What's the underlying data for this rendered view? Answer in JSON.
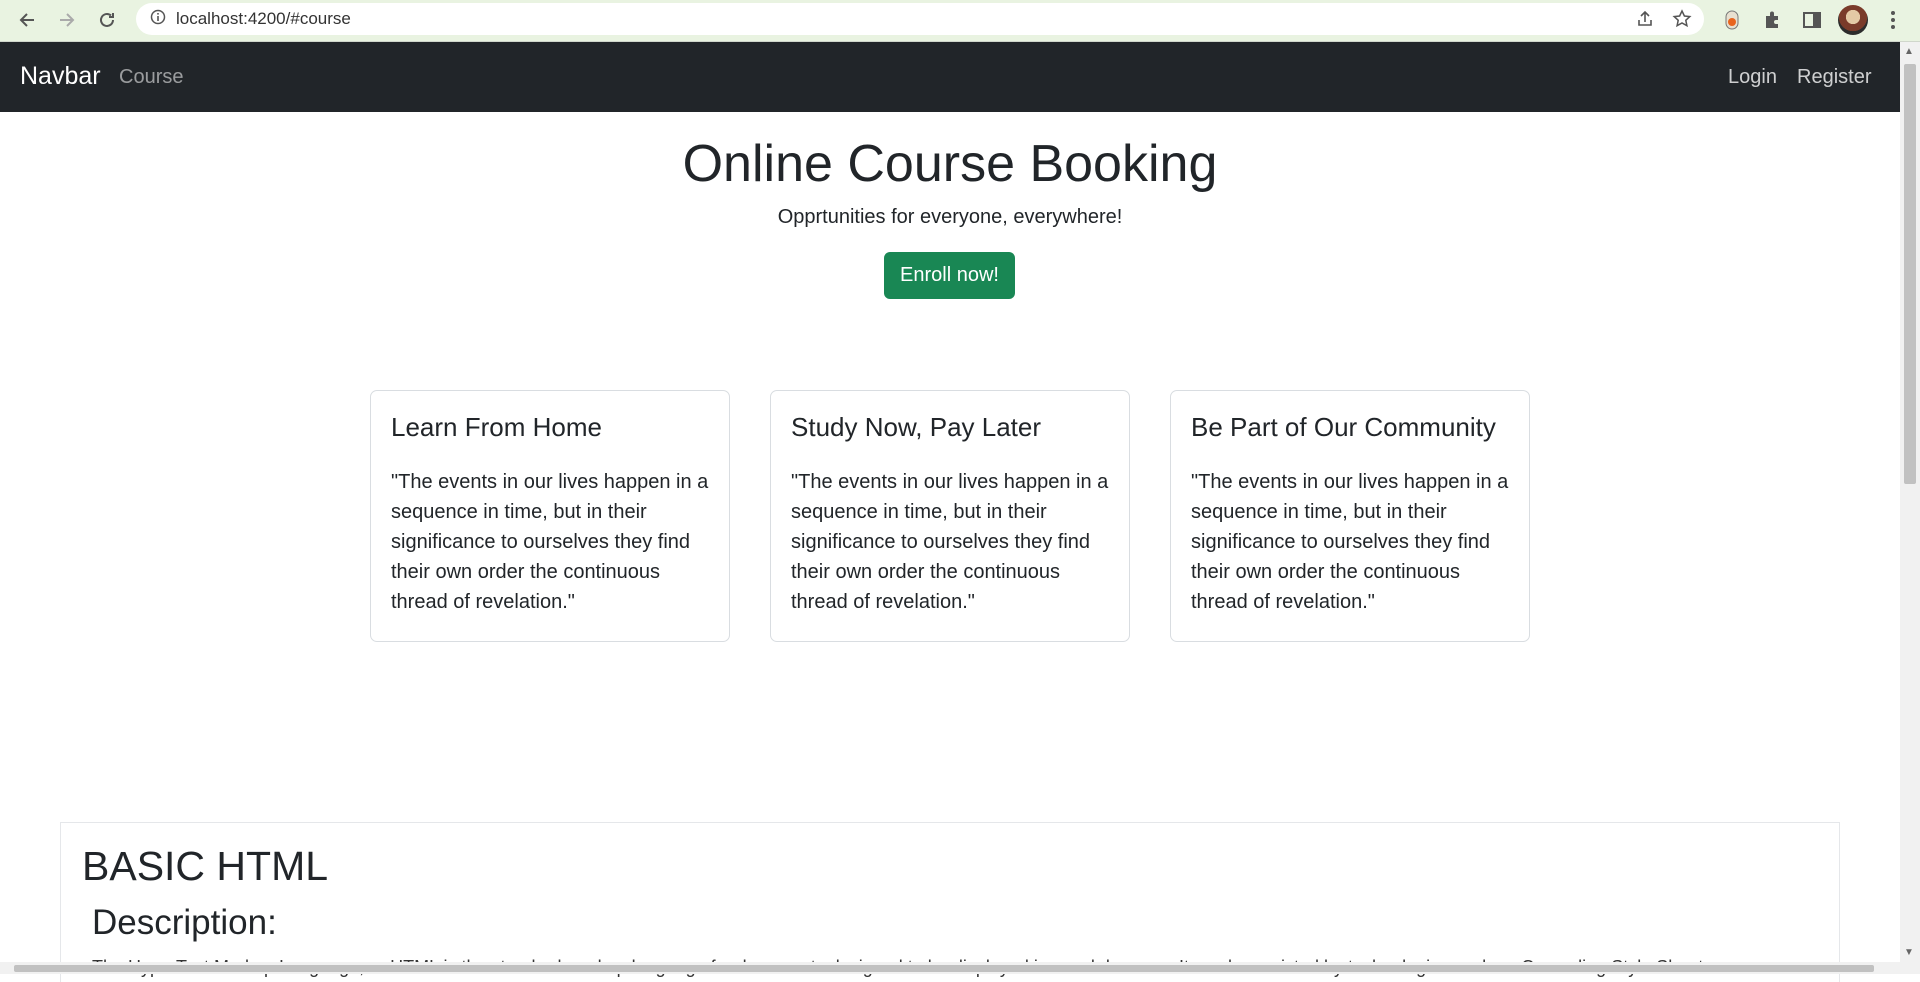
{
  "browser": {
    "url": "localhost:4200/#course"
  },
  "navbar": {
    "brand": "Navbar",
    "links": [
      "Course"
    ],
    "right_links": [
      "Login",
      "Register"
    ]
  },
  "hero": {
    "title": "Online Course Booking",
    "subtitle": "Opprtunities for everyone, everywhere!",
    "cta_label": "Enroll now!"
  },
  "cards": [
    {
      "title": "Learn From Home",
      "text": "\"The events in our lives happen in a sequence in time, but in their significance to ourselves they find their own order the continuous thread of revelation.\""
    },
    {
      "title": "Study Now, Pay Later",
      "text": "\"The events in our lives happen in a sequence in time, but in their significance to ourselves they find their own order the continuous thread of revelation.\""
    },
    {
      "title": "Be Part of Our Community",
      "text": "\"The events in our lives happen in a sequence in time, but in their significance to ourselves they find their own order the continuous thread of revelation.\""
    }
  ],
  "course": {
    "title": "BASIC HTML",
    "description_heading": "Description:",
    "description_text": "The HyperText Markup Language, or HTML is the standard markup language for documents designed to be displayed in a web browser. It can be assisted by technologies such as Cascading Style Sheets"
  },
  "colors": {
    "navbar_bg": "#212529",
    "primary_button": "#198754"
  }
}
